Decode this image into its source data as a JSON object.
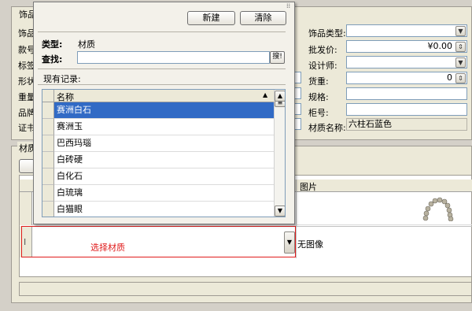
{
  "main": {
    "group_title": "饰品",
    "left_labels": [
      "饰品",
      "款号",
      "标签",
      "形状",
      "重量",
      "品牌",
      "证书"
    ],
    "right_fields": [
      {
        "label": "饰品类型:",
        "value": ""
      },
      {
        "label": "批发价:",
        "value": "¥0.00"
      },
      {
        "label": "设计师:",
        "value": ""
      },
      {
        "label": "货重:",
        "value": "0"
      },
      {
        "label": "规格:",
        "value": ""
      },
      {
        "label": "柜号:",
        "value": ""
      },
      {
        "label": "材质名称:",
        "value": "六柱石蓝色"
      }
    ],
    "material_group_title": "材质",
    "grid_header_image": "图片",
    "row_indicator": "I",
    "select_material_text": "选择材质",
    "no_image_text": "无图像"
  },
  "popup": {
    "new_button": "新建",
    "clear_button": "清除",
    "type_label": "类型:",
    "type_value": "材质",
    "search_label": "查找:",
    "search_value": "",
    "search_button": "搜!",
    "records_label": "现有记录:",
    "list_header": "名称",
    "items": [
      "赛洲白石",
      "赛洲玉",
      "巴西玛瑙",
      "白砖硬",
      "白化石",
      "白琉璃",
      "白猫眼"
    ]
  },
  "colors": {
    "selection": "#316ac5",
    "highlight_border": "#e01b1b",
    "highlight_text": "#e01b1b"
  }
}
